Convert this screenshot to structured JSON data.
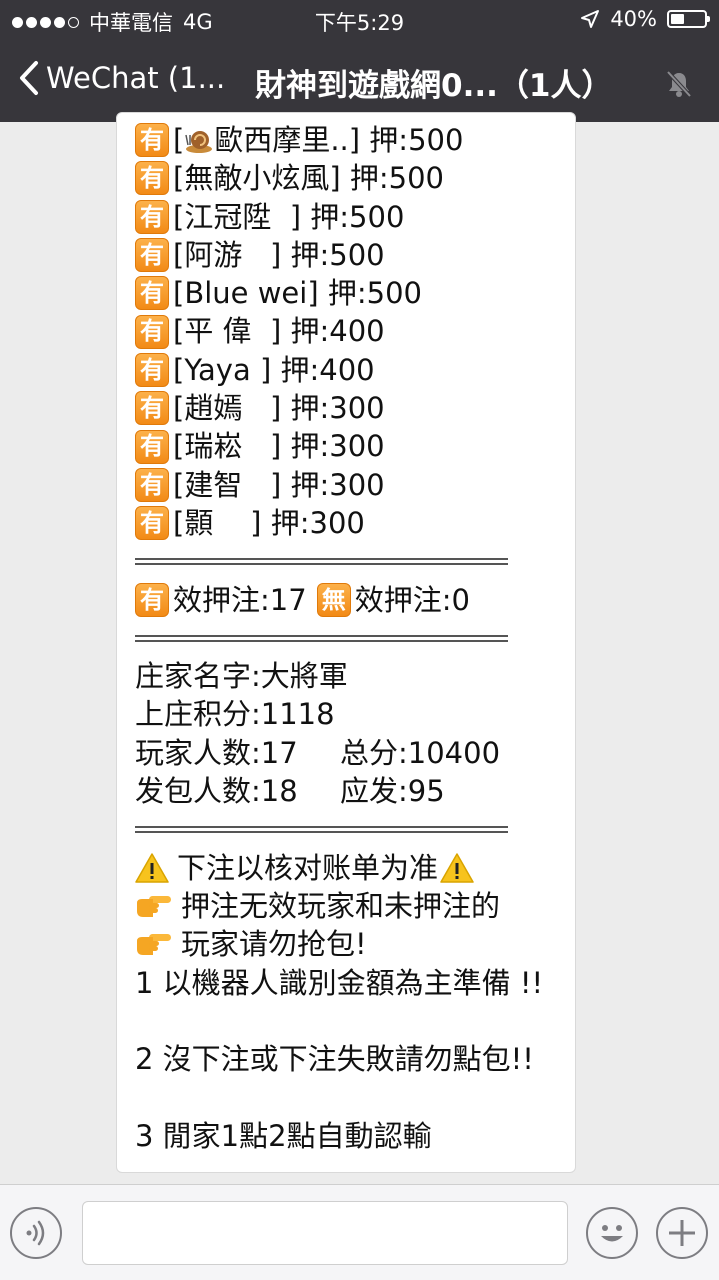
{
  "status_bar": {
    "carrier": "中華電信",
    "network": "4G",
    "time": "下午5:29",
    "battery": "40%",
    "battery_level": 0.4
  },
  "nav": {
    "back_label": "WeChat (1...",
    "title": "財神到遊戲網0...（1人）"
  },
  "message": {
    "bets": [
      {
        "badge": "有",
        "pre": "[",
        "name": "歐西摩里..",
        "post": "] 押:500",
        "has_snail": true
      },
      {
        "badge": "有",
        "pre": "",
        "name": "[無敵小炫風] 押:500",
        "post": "",
        "has_snail": false
      },
      {
        "badge": "有",
        "pre": "",
        "name": "[江冠陞  ] 押:500",
        "post": "",
        "has_snail": false
      },
      {
        "badge": "有",
        "pre": "",
        "name": "[阿游   ] 押:500",
        "post": "",
        "has_snail": false
      },
      {
        "badge": "有",
        "pre": "",
        "name": "[Blue wei] 押:500",
        "post": "",
        "has_snail": false
      },
      {
        "badge": "有",
        "pre": "",
        "name": "[平 偉  ] 押:400",
        "post": "",
        "has_snail": false
      },
      {
        "badge": "有",
        "pre": "",
        "name": "[Yaya ] 押:400",
        "post": "",
        "has_snail": false
      },
      {
        "badge": "有",
        "pre": "",
        "name": "[趙嫣   ] 押:300",
        "post": "",
        "has_snail": false
      },
      {
        "badge": "有",
        "pre": "",
        "name": "[瑞崧   ] 押:300",
        "post": "",
        "has_snail": false
      },
      {
        "badge": "有",
        "pre": "",
        "name": "[建智   ] 押:300",
        "post": "",
        "has_snail": false
      },
      {
        "badge": "有",
        "pre": "",
        "name": "[顥    ] 押:300",
        "post": "",
        "has_snail": false
      }
    ],
    "valid": {
      "badge": "有",
      "text": "效押注:17",
      "invalid_badge": "無",
      "invalid_text": "效押注:0"
    },
    "banker_name": "庄家名字:大將軍",
    "banker_points": "上庄积分:1118",
    "players": "玩家人数:17",
    "total": "总分:10400",
    "packets": "发包人数:18",
    "payout": "应发:95",
    "notice_title": "下注以核对账单为准",
    "notice_1": "押注无效玩家和未押注的",
    "notice_2": "玩家请勿抢包!",
    "rule_1": "1 以機器人識別金額為主準備 !!",
    "rule_2": "2 沒下注或下注失敗請勿點包!!",
    "rule_3": "3 閒家1點2點自動認輸"
  },
  "icons": {
    "back": "chevron-left-icon",
    "mute": "bell-muted-icon",
    "voice": "voice-icon",
    "emoji": "emoji-icon",
    "plus": "plus-icon"
  },
  "colors": {
    "topbar": "#37363b",
    "chat_bg": "#ececec",
    "badge": "#f5941f"
  }
}
